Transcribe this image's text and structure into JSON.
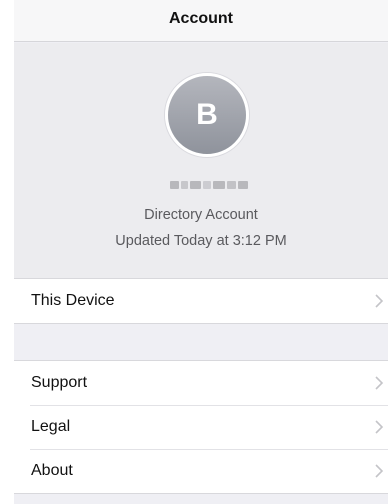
{
  "navbar": {
    "title": "Account"
  },
  "profile": {
    "avatar_initial": "B",
    "line1": "Directory Account",
    "line2": "Updated Today at 3:12 PM"
  },
  "rows": {
    "this_device": "This Device",
    "support": "Support",
    "legal": "Legal",
    "about": "About"
  },
  "icons": {
    "row_disclosure": "chevron-right-icon"
  },
  "colors": {
    "background": "#efeff4",
    "avatar": "#9fa2aa"
  }
}
